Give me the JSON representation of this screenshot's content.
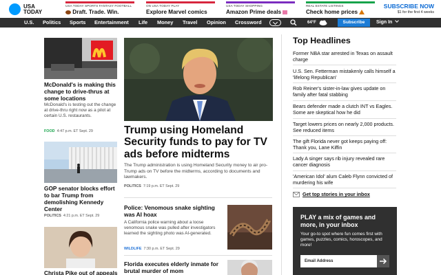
{
  "brand": {
    "line1": "USA",
    "line2": "TODAY",
    "color": "#009bff"
  },
  "promos": [
    {
      "kicker": "USA TODAY SPORTS FANTASY FOOTBALL",
      "icon": "football-icon",
      "title": "Draft. Trade. Win.",
      "color": "#d7263d"
    },
    {
      "kicker": "ON USA TODAY PLAY",
      "title": "Explore Marvel comics",
      "color": "#d7263d"
    },
    {
      "kicker": "USA TODAY SHOPPING",
      "title": "Amazon Prime deals",
      "icon": "gift-icon",
      "color": "#7b2cbf"
    },
    {
      "kicker": "REAL ESTATE LISTINGS",
      "title": "Check home prices",
      "icon": "house-icon",
      "color": "#16a34a"
    }
  ],
  "subscribe": {
    "title": "SUBSCRIBE NOW",
    "subtitle": "$1 for the first 4 weeks"
  },
  "nav": {
    "items": [
      "U.S.",
      "Politics",
      "Sports",
      "Entertainment",
      "Life",
      "Money",
      "Travel",
      "Opinion",
      "Crossword"
    ],
    "weather": "64°F",
    "subscribe": "Subscribe",
    "signin": "Sign In"
  },
  "left": {
    "stories": [
      {
        "title": "McDonald's is making this change to drive-thrus at some locations",
        "summary": "McDonald's is testing out the change at drive-thru right now as a pilot at certain U.S. restaurants.",
        "category": "FOOD",
        "category_color": "#16a34a",
        "time": "4:47 p.m. ET Sept. 29"
      },
      {
        "title": "GOP senator blocks effort to bar Trump from demolishing Kennedy Center",
        "category": "POLITICS",
        "time": "4:21 p.m. ET Sept. 29"
      },
      {
        "title": "Christa Pike out of appeals"
      }
    ]
  },
  "main": {
    "lead": {
      "title": "Trump using Homeland Security funds to pay for TV ads before midterms",
      "summary": "The Trump administration is using Homeland Security money to air pro-Trump ads on TV before the midterms, according to documents and lawmakers.",
      "category": "POLITICS",
      "time": "7:19 p.m. ET Sept. 29"
    },
    "secondary": [
      {
        "title": "Police: Venomous snake sighting was AI hoax",
        "summary": "A California police warning about a loose venomous snake was pulled after investigators learned the sighting photo was AI-generated.",
        "category": "WILDLIFE",
        "category_color": "#1c6fd6",
        "time": "7:30 p.m. ET Sept. 29"
      },
      {
        "title": "Florida executes elderly inmate for brutal murder of mom"
      }
    ]
  },
  "right": {
    "title": "Top Headlines",
    "headlines": [
      "Former NBA star arrested in Texas on assault charge",
      "U.S. Sen. Fetterman mistakenly calls himself a 'lifelong Republican'",
      "Rob Reiner's sister-in-law gives update on family after fatal stabbing",
      "Bears defender made a clutch INT vs Eagles. Some are skeptical how he did",
      "Target lowers prices on nearly 2,000 products. See reduced items",
      "The gift Florida never got keeps paying off: Thank you, Lane Kiffin",
      "Lady A singer says rib injury revealed rare cancer diagnosis",
      "'American Idol' alum Caleb Flynn convicted of murdering his wife"
    ],
    "newsletter_link": "Get top stories in your inbox",
    "newsletter": {
      "title": "PLAY a mix of games and more, in your inbox",
      "description": "Your go-to spot where fun comes first with games, puzzles, comics, horoscopes, and more!",
      "email_placeholder": "Email Address"
    }
  }
}
